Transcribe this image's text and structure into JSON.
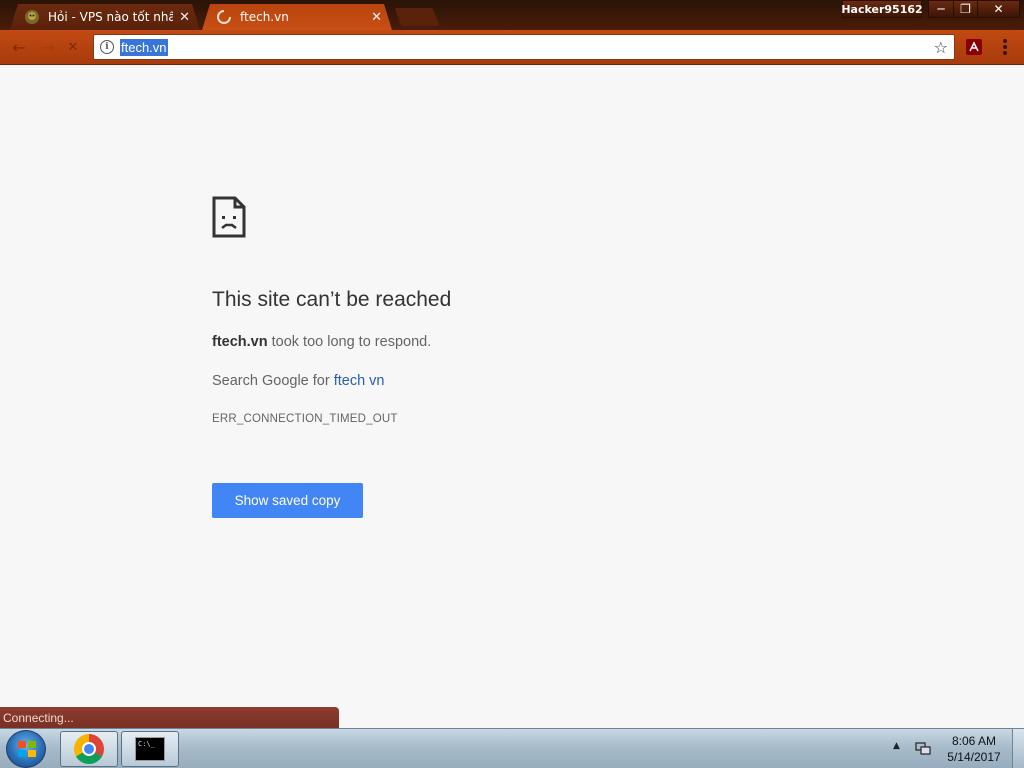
{
  "browser": {
    "tabs": [
      {
        "title": "Hỏi - VPS nào tốt nhất | ",
        "close": "✕",
        "active": false
      },
      {
        "title": "ftech.vn",
        "close": "✕",
        "active": true
      }
    ],
    "profile_name": "Hacker95162",
    "window_controls": {
      "minimize": "─",
      "maximize": "❐",
      "close": "✕"
    },
    "nav": {
      "back": "←",
      "stop": "✕"
    },
    "omnibox": {
      "url": "ftech.vn",
      "star": "☆"
    }
  },
  "error_page": {
    "heading": "This site can’t be reached",
    "domain_bold": "ftech.vn",
    "message_suffix": " took too long to respond.",
    "search_prefix": "Search Google for ",
    "search_link": "ftech vn",
    "error_code": "ERR_CONNECTION_TIMED_OUT",
    "button_label": "Show saved copy"
  },
  "status": {
    "text": "Connecting..."
  },
  "taskbar": {
    "cmd_text": "C:\\_",
    "tray_arrow": "▲",
    "clock_time": "8:06 AM",
    "clock_date": "5/14/2017"
  },
  "colors": {
    "accent_button": "#4285f4",
    "link": "#2a5db0",
    "toolbar": "#b8440f"
  }
}
